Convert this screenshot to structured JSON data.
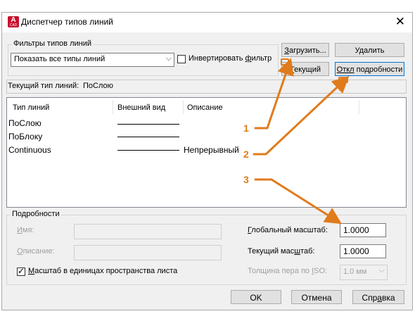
{
  "window": {
    "title": "Диспетчер типов линий",
    "icon_name": "autocad-app-icon",
    "icon_text": "A",
    "icon_sub": "CAD"
  },
  "filters": {
    "group_label": "Фильтры типов линий",
    "selected": "Показать все типы линий",
    "invert_label_pre": "Инвертировать ",
    "invert_label_ul": "ф",
    "invert_label_post": "ильтр",
    "invert_checked": false
  },
  "buttons": {
    "load_ul": "З",
    "load_rest": "агрузить...",
    "delete": "Удалить",
    "current_ul": "Т",
    "current_rest": "екущий",
    "details_ul": "Откл",
    "details_rest": " подробности",
    "ok": "OK",
    "cancel": "Отмена",
    "help_pre": "Спр",
    "help_ul": "а",
    "help_post": "вка"
  },
  "current_linetype": {
    "label": "Текущий тип линий:",
    "value": "ПоСлою"
  },
  "table": {
    "columns": [
      "Тип линий",
      "Внешний вид",
      "Описание"
    ],
    "rows": [
      {
        "name": "ПоСлою",
        "appearance": "solid-line",
        "description": ""
      },
      {
        "name": "ПоБлоку",
        "appearance": "solid-line",
        "description": ""
      },
      {
        "name": "Continuous",
        "appearance": "solid-line",
        "description": "Непрерывный"
      }
    ]
  },
  "details": {
    "group_label": "Подробности",
    "name_label_ul": "И",
    "name_label_rest": "мя:",
    "desc_label_ul": "О",
    "desc_label_rest": "писание:",
    "paper_space_ul": "М",
    "paper_space_rest": "асштаб в единицах пространства листа",
    "paper_space_checked": true,
    "global_scale_ul": "Г",
    "global_scale_rest": "лобальный масштаб:",
    "global_scale_value": "1.0000",
    "current_scale_pre": "Текущий мас",
    "current_scale_ul": "ш",
    "current_scale_post": "таб:",
    "current_scale_value": "1.0000",
    "pen_width_pre": "Толщина пера по ",
    "pen_width_ul": "I",
    "pen_width_post": "SO:",
    "pen_width_value": "1.0 мм"
  },
  "annotations": {
    "color": "#e07b1b",
    "markers": [
      "1",
      "2",
      "3"
    ]
  }
}
